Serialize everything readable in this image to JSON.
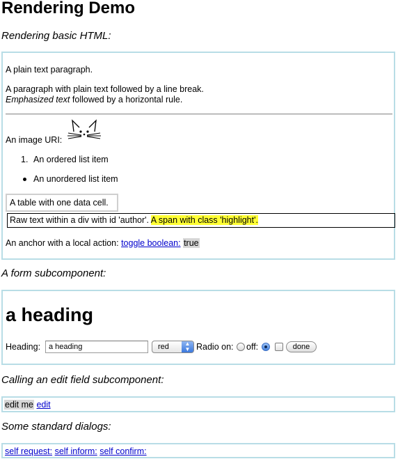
{
  "page_title": "Rendering Demo",
  "sections": {
    "basic_html": "Rendering basic HTML:",
    "form": "A form subcomponent:",
    "edit_field": "Calling an edit field subcomponent:",
    "dialogs": "Some standard dialogs:"
  },
  "basic": {
    "plain_paragraph": "A plain text paragraph.",
    "line_break_text": "A paragraph with plain text followed by a line break.",
    "emphasized": "Emphasized text",
    "hr_followup": " followed by a horizontal rule.",
    "image_label": "An image URI:",
    "ordered_marker": "1.",
    "ordered_item": "An ordered list item",
    "unordered_item": "An unordered list item",
    "table_cell": "A table with one data cell.",
    "author_text": "Raw text within a div with id 'author'. ",
    "highlight_span": "A span with class 'highlight'.",
    "anchor_label": "An anchor with a local action: ",
    "toggle_link": "toggle boolean:",
    "boolean_value": "true"
  },
  "form": {
    "heading": "a heading",
    "heading_label": "Heading:",
    "heading_value": "a heading",
    "color_selected": "red",
    "radio_label": "Radio on:",
    "off_label": "off:",
    "done_button": "done"
  },
  "edit_field": {
    "value": "edit me",
    "edit_link": "edit"
  },
  "dialogs": {
    "request": "self request:",
    "inform": "self inform:",
    "confirm": "self confirm:"
  },
  "colors": {
    "panel_border": "#b8dde6",
    "highlight": "#ffff33",
    "link": "#0000cc",
    "value_background": "#d6d6d6"
  },
  "icons": {
    "image": "cat-face-icon",
    "select_arrow": "updown-arrows-icon"
  }
}
